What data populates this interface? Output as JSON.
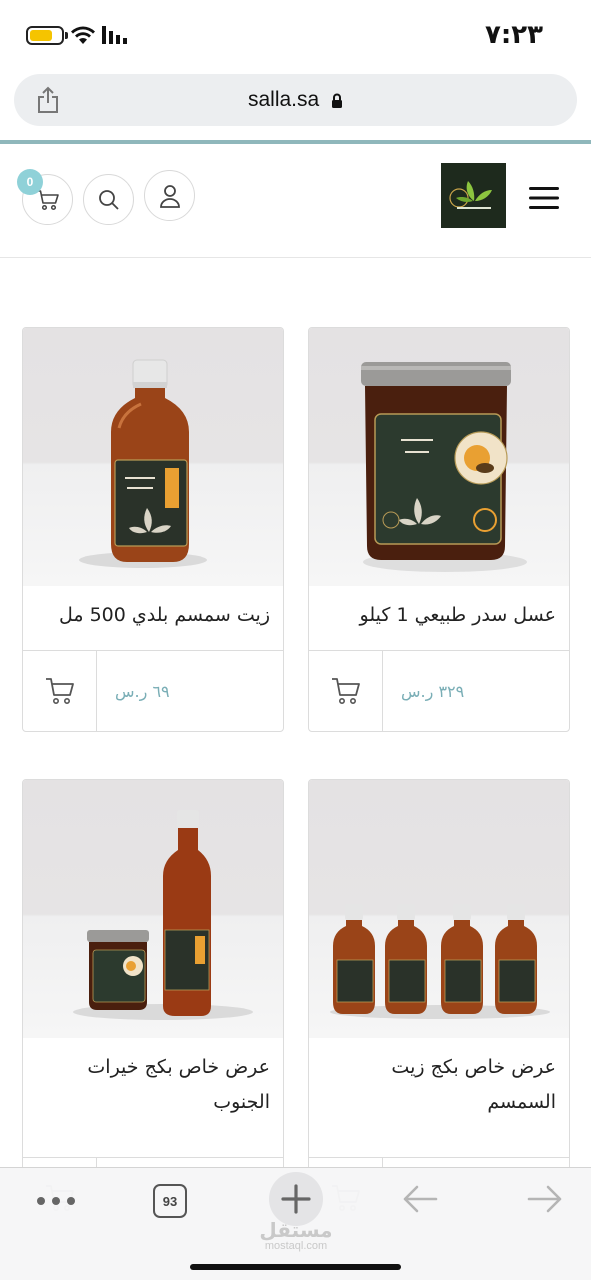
{
  "status_bar": {
    "time": "٧:٢٣",
    "battery_icon": "battery-icon",
    "wifi_icon": "wifi-icon",
    "signal_icon": "signal-icon"
  },
  "browser": {
    "url": "salla.sa",
    "share_icon": "share-icon",
    "lock_icon": "lock-icon"
  },
  "store_header": {
    "cart_count": "0",
    "logo_text": "خيرات الجنوب",
    "colors": {
      "badge": "#8fd1d8",
      "logo_bg": "#1e2a1d"
    }
  },
  "products": [
    {
      "name": "عسل سدر طبيعي 1 كيلو",
      "price": "٣٢٩ ر.س"
    },
    {
      "name": "زيت سمسم بلدي 500 مل",
      "price": "٦٩ ر.س"
    },
    {
      "name": "عرض خاص بكج زيت السمسم",
      "price": ""
    },
    {
      "name": "عرض خاص بكج خيرات الجنوب",
      "price": ""
    }
  ],
  "toolbar": {
    "tab_count": "93",
    "watermark_arabic": "مستقل",
    "watermark_latin": "mostaql.com"
  },
  "theme": {
    "accent": "#7aaeb6",
    "url_bar_underline": "#8fb7bb"
  }
}
